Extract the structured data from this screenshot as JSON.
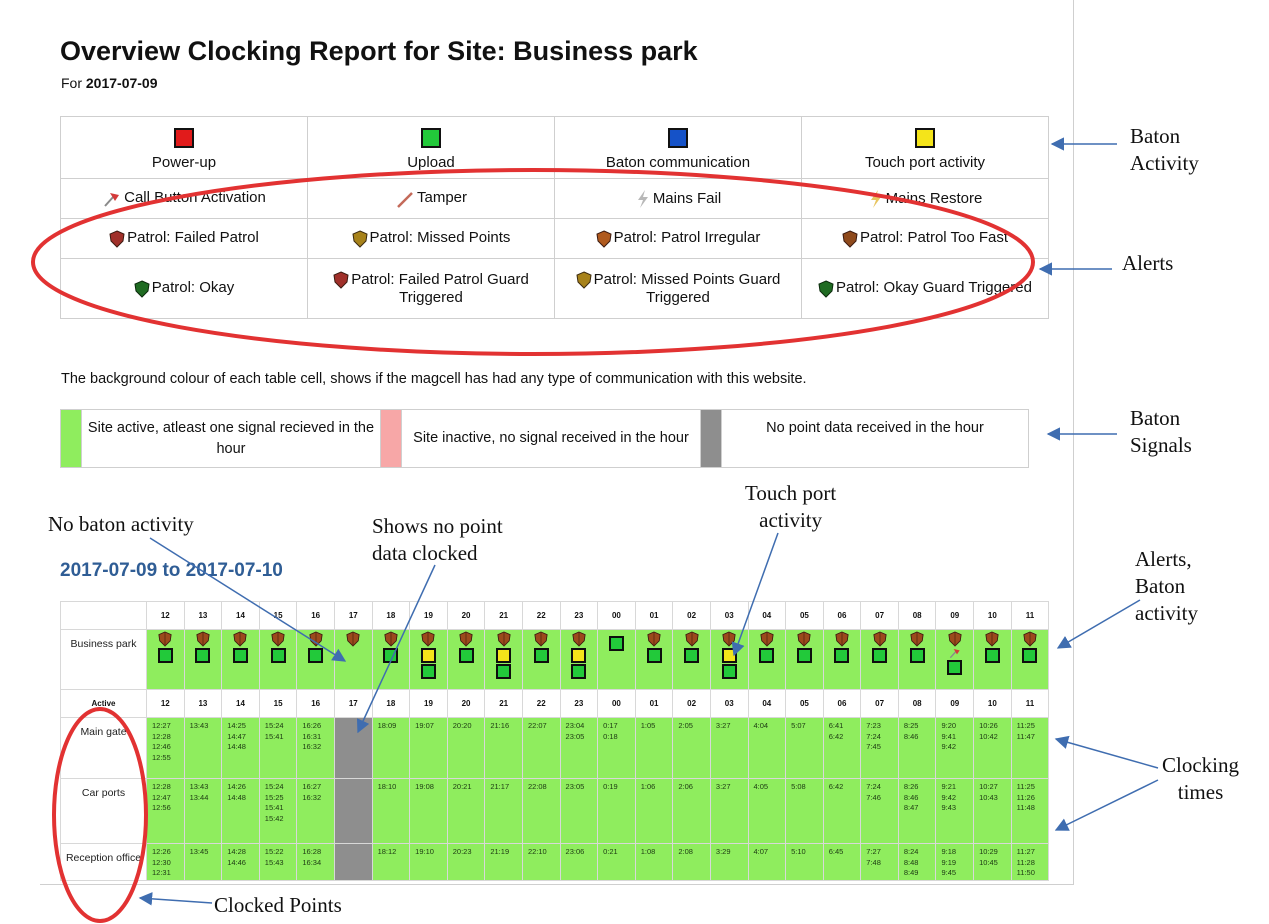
{
  "title": "Overview Clocking Report for Site: Business park",
  "date_prefix": "For",
  "date": "2017-07-09",
  "legend": {
    "baton_activity": [
      {
        "label": "Power-up",
        "color": "#e11b1b"
      },
      {
        "label": "Upload",
        "color": "#22c93a"
      },
      {
        "label": "Baton communication",
        "color": "#1552c8"
      },
      {
        "label": "Touch port activity",
        "color": "#f4e41a"
      }
    ],
    "alerts": [
      {
        "label": "Call Button Activation",
        "icon": "call-button-icon"
      },
      {
        "label": "Tamper",
        "icon": "tamper-icon"
      },
      {
        "label": "Mains Fail",
        "icon": "lightning-icon"
      },
      {
        "label": "Mains Restore",
        "icon": "lightning-icon"
      },
      {
        "label": "Patrol: Failed Patrol",
        "icon": "shield-icon",
        "color": "#a0302a"
      },
      {
        "label": "Patrol: Missed Points",
        "icon": "shield-icon",
        "color": "#a7821a"
      },
      {
        "label": "Patrol: Patrol Irregular",
        "icon": "shield-icon",
        "color": "#b05a1e"
      },
      {
        "label": "Patrol: Patrol Too Fast",
        "icon": "shield-icon",
        "color": "#8f4a1c"
      },
      {
        "label": "Patrol: Okay",
        "icon": "shield-icon",
        "color": "#1f6b22"
      },
      {
        "label": "Patrol: Failed Patrol Guard Triggered",
        "icon": "shield-icon",
        "color": "#a0302a"
      },
      {
        "label": "Patrol: Missed Points Guard Triggered",
        "icon": "shield-icon",
        "color": "#a7821a"
      },
      {
        "label": "Patrol: Okay Guard Triggered",
        "icon": "shield-icon",
        "color": "#1f6b22"
      }
    ]
  },
  "note": "The background colour of each table cell, shows if the magcell has had any type of communication with this website.",
  "signals": [
    {
      "label": "Site active, atleast one signal recieved in the hour",
      "color": "#8fed5e"
    },
    {
      "label": "Site inactive, no signal received in the hour",
      "color": "#f7a7a7"
    },
    {
      "label": "No point data received in the hour",
      "color": "#8e8e8e"
    }
  ],
  "range_title": "2017-07-09 to 2017-07-10",
  "hours": [
    "12",
    "13",
    "14",
    "15",
    "16",
    "17",
    "18",
    "19",
    "20",
    "21",
    "22",
    "23",
    "00",
    "01",
    "02",
    "03",
    "04",
    "05",
    "06",
    "07",
    "08",
    "09",
    "10",
    "11"
  ],
  "site_row_label": "Business park",
  "site_activity": [
    "sg",
    "sg",
    "sg",
    "sg",
    "sg",
    "s",
    "sg",
    "syg",
    "sg",
    "syg",
    "sg",
    "syg",
    "g",
    "sg",
    "sg",
    "syg",
    "sg",
    "sg",
    "sg",
    "sg",
    "sg",
    "sfg",
    "sg",
    "sg"
  ],
  "active_label": "Active",
  "points": [
    {
      "label": "Main gate",
      "times": [
        "12:27\n12:28\n12:46\n12:55",
        "13:43",
        "14:25\n14:47\n14:48",
        "15:24\n15:41",
        "16:26\n16:31\n16:32",
        "",
        "18:09",
        "19:07",
        "20:20",
        "21:16",
        "22:07",
        "23:04\n23:05",
        "0:17\n0:18",
        "1:05",
        "2:05",
        "3:27",
        "4:04",
        "5:07",
        "6:41\n6:42",
        "7:23\n7:24\n7:45",
        "8:25\n8:46",
        "9:20\n9:41\n9:42",
        "10:26\n10:42",
        "11:25\n11:47"
      ]
    },
    {
      "label": "Car ports",
      "times": [
        "12:28\n12:47\n12:56",
        "13:43\n13:44",
        "14:26\n14:48",
        "15:24\n15:25\n15:41\n15:42",
        "16:27\n16:32",
        "",
        "18:10",
        "19:08",
        "20:21",
        "21:17",
        "22:08",
        "23:05",
        "0:19",
        "1:06",
        "2:06",
        "3:27",
        "4:05",
        "5:08",
        "6:42",
        "7:24\n7:46",
        "8:26\n8:46\n8:47",
        "9:21\n9:42\n9:43",
        "10:27\n10:43",
        "11:25\n11:26\n11:48"
      ]
    },
    {
      "label": "Reception office",
      "times": [
        "12:26\n12:30\n12:31",
        "13:45",
        "14:28\n14:46",
        "15:22\n15:43",
        "16:28\n16:34",
        "",
        "18:12",
        "19:10",
        "20:23",
        "21:19",
        "22:10",
        "23:06",
        "0:21",
        "1:08",
        "2:08",
        "3:29",
        "4:07",
        "5:10",
        "6:45",
        "7:27\n7:48",
        "8:24\n8:48\n8:49",
        "9:18\n9:19\n9:45",
        "10:29\n10:45",
        "11:27\n11:28\n11:50"
      ]
    }
  ],
  "annotations": {
    "baton_activity": "Baton\nActivity",
    "alerts": "Alerts",
    "baton_signals": "Baton\nSignals",
    "no_baton_activity": "No baton activity",
    "no_point_data": "Shows no point\ndata clocked",
    "touch_port": "Touch port\nactivity",
    "alerts_baton": "Alerts,\nBaton\nactivity",
    "clocking_times": "Clocking\ntimes",
    "clocked_points": "Clocked Points"
  }
}
